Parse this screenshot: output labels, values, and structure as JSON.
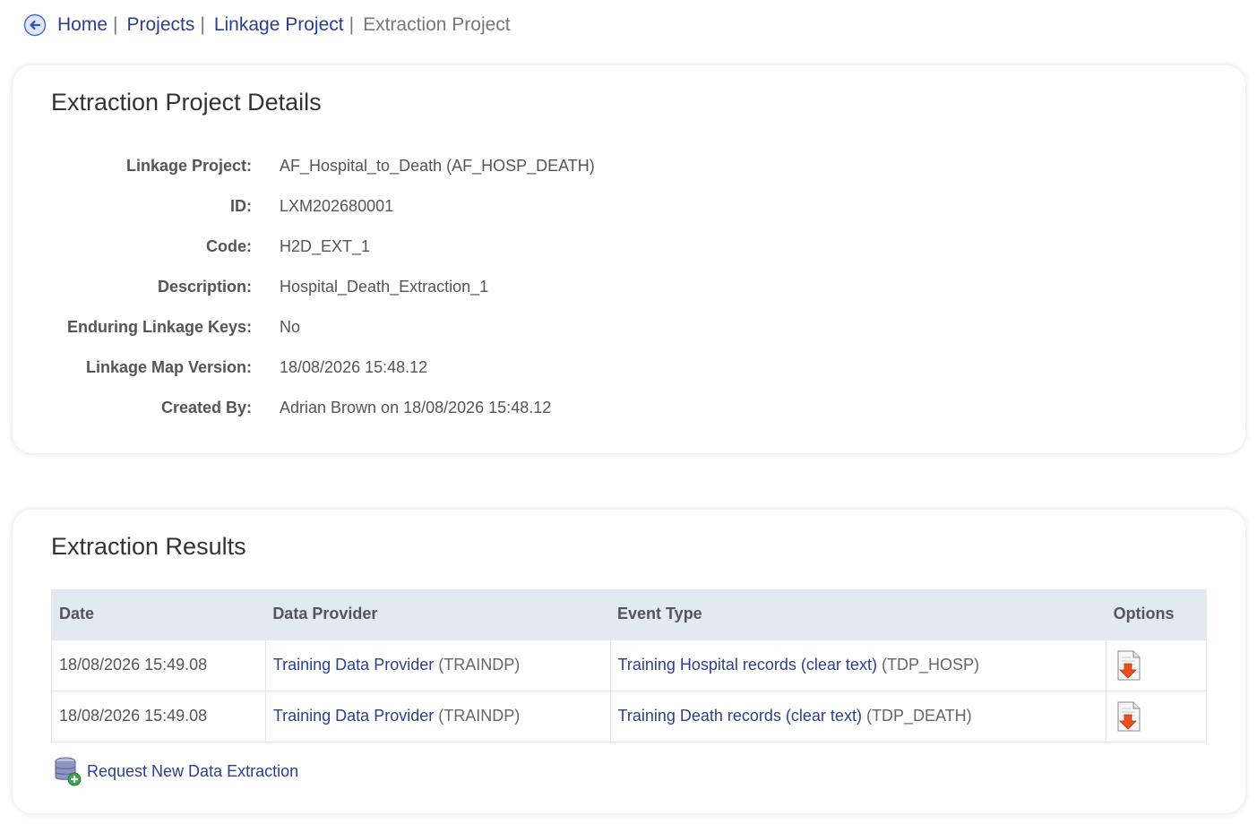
{
  "breadcrumb": {
    "items": [
      "Home",
      "Projects",
      "Linkage Project"
    ],
    "separator": "|",
    "current": "Extraction Project"
  },
  "details": {
    "title": "Extraction Project Details",
    "rows": [
      {
        "label": "Linkage Project:",
        "value": "AF_Hospital_to_Death (AF_HOSP_DEATH)"
      },
      {
        "label": "ID:",
        "value": "LXM202680001"
      },
      {
        "label": "Code:",
        "value": "H2D_EXT_1"
      },
      {
        "label": "Description:",
        "value": "Hospital_Death_Extraction_1"
      },
      {
        "label": "Enduring Linkage Keys:",
        "value": "No"
      },
      {
        "label": "Linkage Map Version:",
        "value": "18/08/2026 15:48.12"
      },
      {
        "label": "Created By:",
        "value": "Adrian Brown on 18/08/2026 15:48.12"
      }
    ]
  },
  "results": {
    "title": "Extraction Results",
    "columns": [
      "Date",
      "Data Provider",
      "Event Type",
      "Options"
    ],
    "rows": [
      {
        "date": "18/08/2026 15:49.08",
        "provider_name": "Training Data Provider",
        "provider_code": "(TRAINDP)",
        "event_name": "Training Hospital records (clear text)",
        "event_code": "(TDP_HOSP)",
        "option_icon": "download-document-icon"
      },
      {
        "date": "18/08/2026 15:49.08",
        "provider_name": "Training Data Provider",
        "provider_code": "(TRAINDP)",
        "event_name": "Training Death records (clear text)",
        "event_code": "(TDP_DEATH)",
        "option_icon": "download-document-icon"
      }
    ],
    "request_link": "Request New Data Extraction"
  },
  "colors": {
    "link": "#2b3f8c",
    "header_bg": "#e3e9f0",
    "download_arrow": "#e8501e"
  }
}
